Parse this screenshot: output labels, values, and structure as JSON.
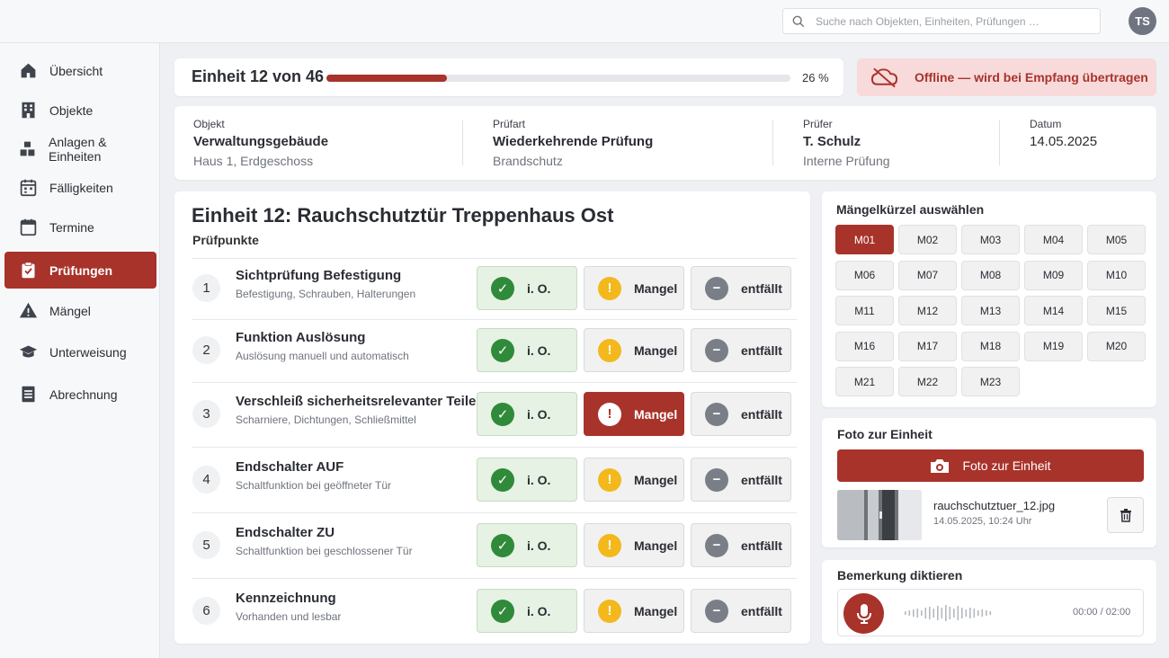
{
  "header": {
    "search_placeholder": "Suche nach Objekten, Einheiten, Prüfungen …",
    "user_initials": "TS"
  },
  "sidebar": {
    "items": [
      {
        "label": "Übersicht",
        "icon": "home-icon"
      },
      {
        "label": "Objekte",
        "icon": "building-icon"
      },
      {
        "label": "Anlagen & Einheiten",
        "icon": "blocks-icon"
      },
      {
        "label": "Fälligkeiten",
        "icon": "calendar-grid-icon"
      },
      {
        "label": "Termine",
        "icon": "calendar-icon"
      },
      {
        "label": "Prüfungen",
        "icon": "clipboard-check-icon",
        "active": true
      },
      {
        "label": "Mängel",
        "icon": "warning-icon"
      },
      {
        "label": "Unterweisung",
        "icon": "graduation-cap-icon"
      },
      {
        "label": "Abrechnung",
        "icon": "document-lines-icon"
      }
    ]
  },
  "progress": {
    "label": "Einheit 12 von 46",
    "percent_text": "26 %",
    "fraction": 0.26
  },
  "offline": {
    "text": "Offline — wird bei Empfang übertragen"
  },
  "info": {
    "objekt": {
      "label": "Objekt",
      "value": "Verwaltungsgebäude",
      "sub": "Haus 1, Erdgeschoss"
    },
    "pruefart": {
      "label": "Prüfart",
      "value": "Wiederkehrende Prüfung",
      "sub": "Brandschutz"
    },
    "pruefer": {
      "label": "Prüfer",
      "value": "T. Schulz",
      "sub": "Interne Prüfung"
    },
    "datum": {
      "label": "Datum",
      "value": "14.05.2025"
    }
  },
  "unit": {
    "title": "Einheit 12: Rauchschutztür Treppenhaus Ost",
    "section_label": "Prüfpunkte",
    "button_labels": {
      "ok": "i. O.",
      "defect": "Mangel",
      "na": "entfällt"
    },
    "points": [
      {
        "num": "1",
        "title": "Sichtprüfung Befestigung",
        "sub": "Befestigung, Schrauben, Halterungen",
        "status": "ok"
      },
      {
        "num": "2",
        "title": "Funktion Auslösung",
        "sub": "Auslösung manuell und automatisch",
        "status": "ok"
      },
      {
        "num": "3",
        "title": "Verschleiß sicherheitsrelevanter Teile",
        "sub": "Scharniere, Dichtungen, Schließmittel",
        "status": "defect"
      },
      {
        "num": "4",
        "title": "Endschalter AUF",
        "sub": "Schaltfunktion bei geöffneter Tür",
        "status": "ok"
      },
      {
        "num": "5",
        "title": "Endschalter ZU",
        "sub": "Schaltfunktion bei geschlossener Tür",
        "status": "ok"
      },
      {
        "num": "6",
        "title": "Kennzeichnung",
        "sub": "Vorhanden und lesbar",
        "status": "ok"
      }
    ]
  },
  "defect_codes": {
    "title": "Mängelkürzel auswählen",
    "selected": "M01",
    "codes": [
      "M01",
      "M02",
      "M03",
      "M04",
      "M05",
      "M06",
      "M07",
      "M08",
      "M09",
      "M10",
      "M11",
      "M12",
      "M13",
      "M14",
      "M15",
      "M16",
      "M17",
      "M18",
      "M19",
      "M20",
      "M21",
      "M22",
      "M23"
    ]
  },
  "photo": {
    "title": "Foto zur Einheit",
    "button_label": "Foto zur Einheit",
    "filename": "rauchschutztuer_12.jpg",
    "timestamp": "14.05.2025, 10:24 Uhr"
  },
  "voice": {
    "title": "Bemerkung diktieren",
    "time": "00:00 / 02:00"
  },
  "colors": {
    "accent": "#a8332b",
    "ok_green": "#2f8a3a",
    "warning_yellow": "#f3b81c",
    "offline_bg": "#f8dada"
  }
}
